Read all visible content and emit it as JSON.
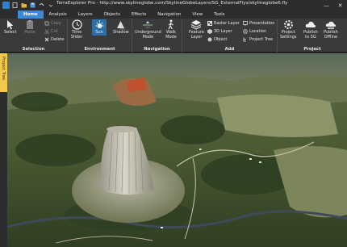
{
  "window": {
    "title": "TerraExplorer Pro - http://www.skylineglobe.com/SkylineGlobeLayers/SG_ExternalFlys/skylineglobe6.fly",
    "controls": {
      "minimize": "—",
      "close": "✕"
    }
  },
  "tabs": [
    "Home",
    "Analysis",
    "Layers",
    "Objects",
    "Effects",
    "Navigation",
    "View",
    "Tools"
  ],
  "ribbon": {
    "selection": {
      "label": "Selection",
      "select": "Select",
      "paste": "Paste",
      "copy": "Copy",
      "cut": "Cut",
      "delete": "Delete"
    },
    "environment": {
      "label": "Environment",
      "time_slider": "Time\nSlider",
      "sun": "Sun",
      "shadow": "Shadow"
    },
    "navigation": {
      "label": "Navigation",
      "underground": "Underground\nMode",
      "walk": "Walk\nMode"
    },
    "add": {
      "label": "Add",
      "feature_layer": "Feature\nLayer",
      "raster_layer": "Raster Layer",
      "layer_3d": "3D Layer",
      "object": "Object",
      "presentation": "Presentation",
      "location": "Location",
      "project_tree": "Project Tree"
    },
    "project": {
      "label": "Project",
      "settings": "Project\nSettings",
      "publish_sg": "Publish\nto SG",
      "publish_offline": "Publish\nOffline"
    }
  },
  "side_panel": {
    "tab": "Project Tree"
  },
  "colors": {
    "accent": "#3b8ad8",
    "ribbon": "#383a3c",
    "side_tab": "#f2c94c"
  }
}
